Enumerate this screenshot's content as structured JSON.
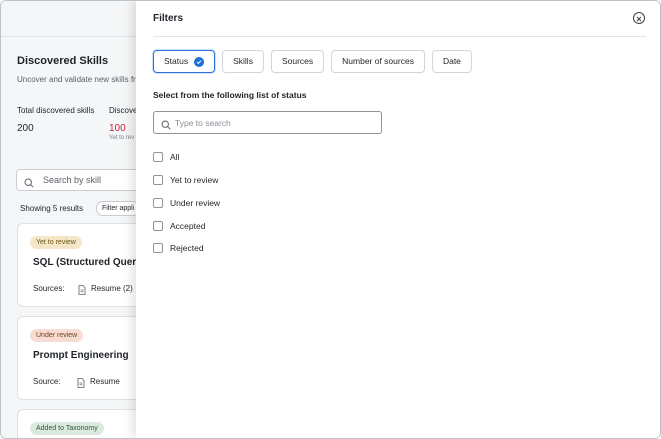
{
  "background": {
    "title": "Discovered Skills",
    "subtitle": "Uncover and validate new skills fr",
    "stats": [
      {
        "label": "Total discovered skills",
        "value": "200",
        "color": "#1f2328"
      },
      {
        "label": "Discove",
        "value": "100",
        "color": "#d0213f",
        "note": "Yet to rev"
      }
    ],
    "search_placeholder": "Search by skill",
    "results_text": "Showing 5 results",
    "filter_chip": "Filter appli",
    "cards": [
      {
        "badge": "Yet to review",
        "badge_bg": "#f5e6c8",
        "badge_fg": "#6b5416",
        "title": "SQL (Structured Query L",
        "source_label": "Sources:",
        "source_value": "Resume (2)"
      },
      {
        "badge": "Under review",
        "badge_bg": "#f6dcd2",
        "badge_fg": "#7a3a21",
        "title": "Prompt Engineering",
        "source_label": "Source:",
        "source_value": "Resume"
      },
      {
        "badge": "Added to Taxonomy",
        "badge_bg": "#dbe9df",
        "badge_fg": "#2f5a3c"
      }
    ]
  },
  "filters": {
    "title": "Filters",
    "tabs": [
      {
        "label": "Status",
        "active": true
      },
      {
        "label": "Skills"
      },
      {
        "label": "Sources"
      },
      {
        "label": "Number of sources"
      },
      {
        "label": "Date"
      }
    ],
    "section_label": "Select from the following list of status",
    "search_placeholder": "Type to search",
    "options": [
      "All",
      "Yet to review",
      "Under review",
      "Accepted",
      "Rejected"
    ],
    "accent_color": "#1f6fd6"
  }
}
